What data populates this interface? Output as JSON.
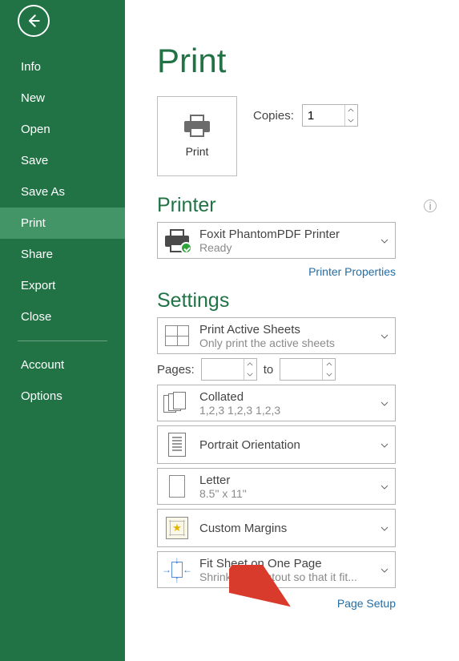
{
  "sidebar": {
    "items": [
      {
        "label": "Info"
      },
      {
        "label": "New"
      },
      {
        "label": "Open"
      },
      {
        "label": "Save"
      },
      {
        "label": "Save As"
      },
      {
        "label": "Print"
      },
      {
        "label": "Share"
      },
      {
        "label": "Export"
      },
      {
        "label": "Close"
      }
    ],
    "footer": [
      {
        "label": "Account"
      },
      {
        "label": "Options"
      }
    ]
  },
  "page": {
    "title": "Print",
    "print_button": "Print",
    "copies_label": "Copies:",
    "copies_value": "1"
  },
  "printer_section": {
    "heading": "Printer",
    "selected_name": "Foxit PhantomPDF Printer",
    "selected_status": "Ready",
    "properties_link": "Printer Properties"
  },
  "settings_section": {
    "heading": "Settings",
    "print_what": {
      "title": "Print Active Sheets",
      "sub": "Only print the active sheets"
    },
    "pages_label": "Pages:",
    "pages_to": "to",
    "collate": {
      "title": "Collated",
      "sub": "1,2,3    1,2,3    1,2,3"
    },
    "orientation": {
      "title": "Portrait Orientation"
    },
    "paper": {
      "title": "Letter",
      "sub": "8.5\" x 11\""
    },
    "margins": {
      "title": "Custom Margins"
    },
    "scaling": {
      "title": "Fit Sheet on One Page",
      "sub": "Shrink the printout so that it fit..."
    },
    "page_setup_link": "Page Setup"
  }
}
